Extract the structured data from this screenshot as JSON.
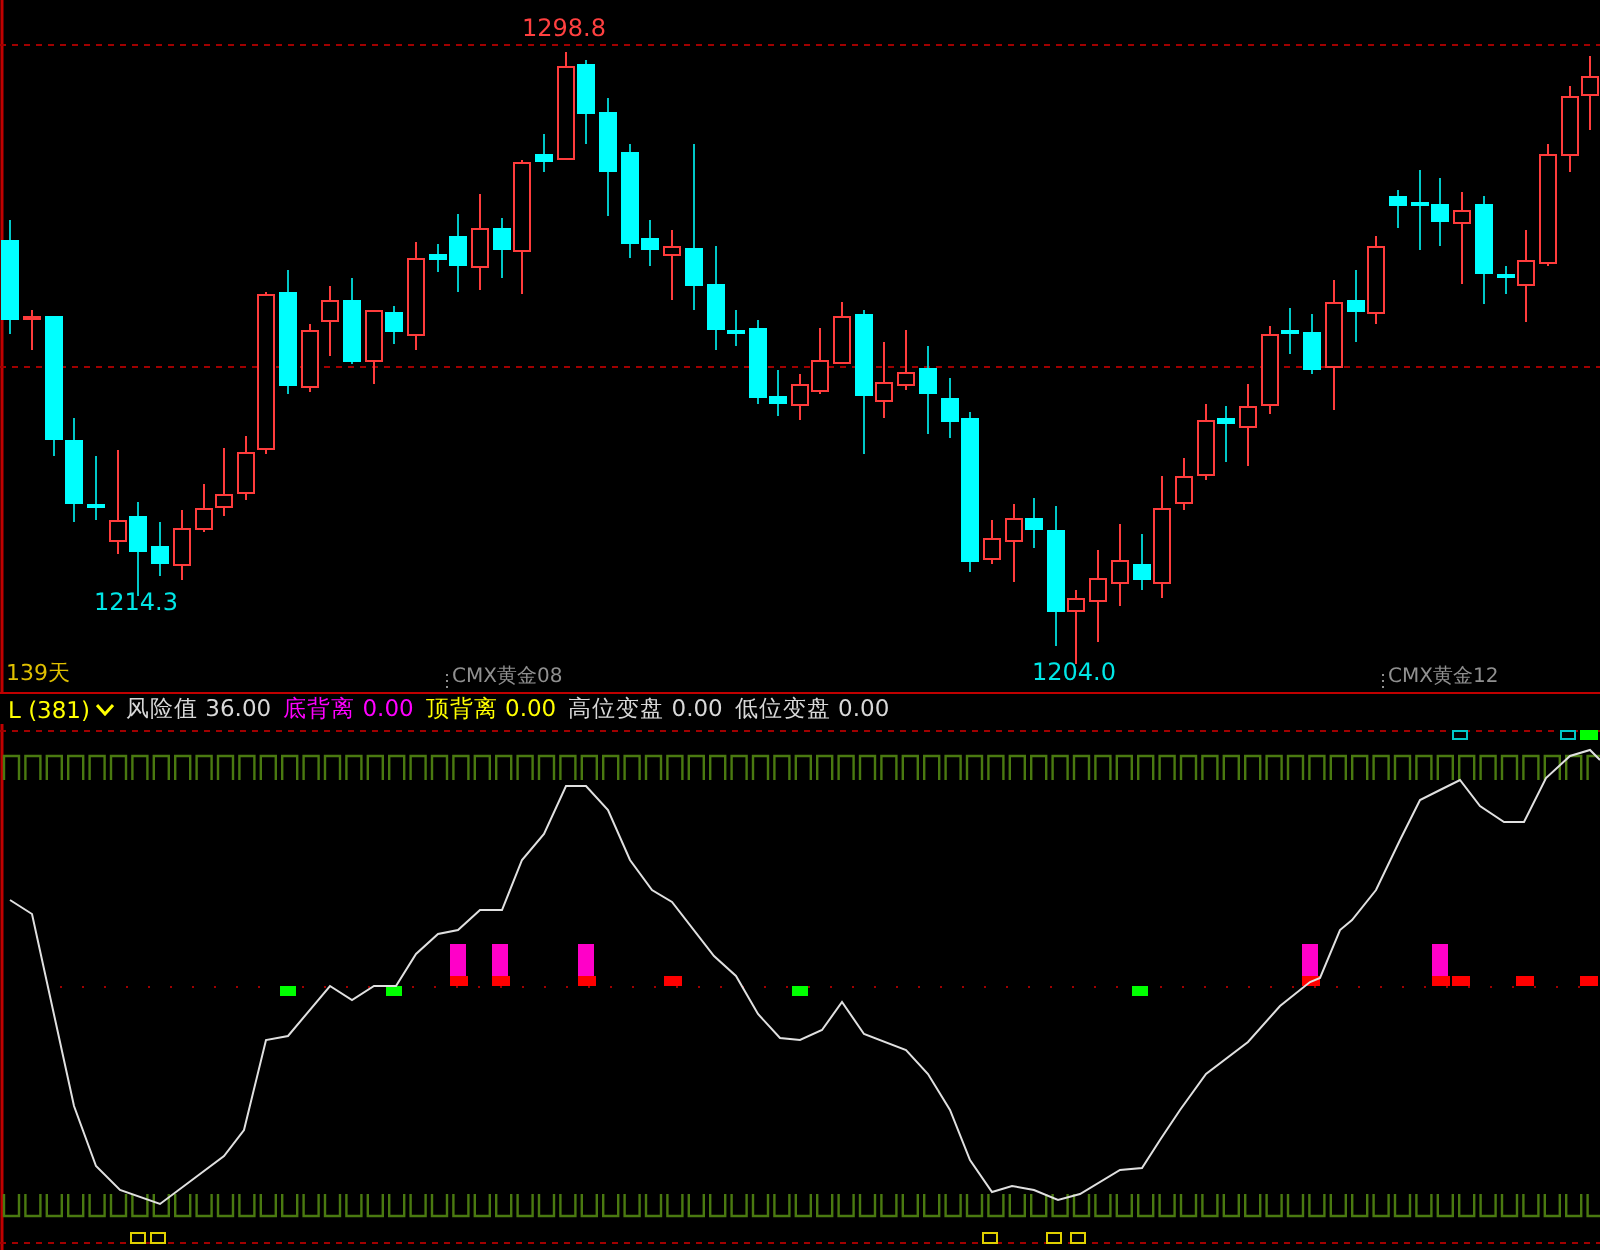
{
  "price_chart": {
    "price_labels": [
      {
        "text": "1298.8",
        "kind": "high"
      },
      {
        "text": "1214.3",
        "kind": "low"
      },
      {
        "text": "1204.0",
        "kind": "low"
      }
    ],
    "period": "139天",
    "contract_labels": [
      "CMX黄金08",
      "CMX黄金12"
    ]
  },
  "indicator": {
    "name": "L (381)",
    "values": [
      {
        "label": "风险值",
        "value": "36.00",
        "color": "#d8d8d8"
      },
      {
        "label": "底背离",
        "value": "0.00",
        "color": "#ff00ff"
      },
      {
        "label": "顶背离",
        "value": "0.00",
        "color": "#ffff00"
      },
      {
        "label": "高位变盘",
        "value": "0.00",
        "color": "#d8d8d8"
      },
      {
        "label": "低位变盘",
        "value": "0.00",
        "color": "#d8d8d8"
      }
    ]
  }
}
